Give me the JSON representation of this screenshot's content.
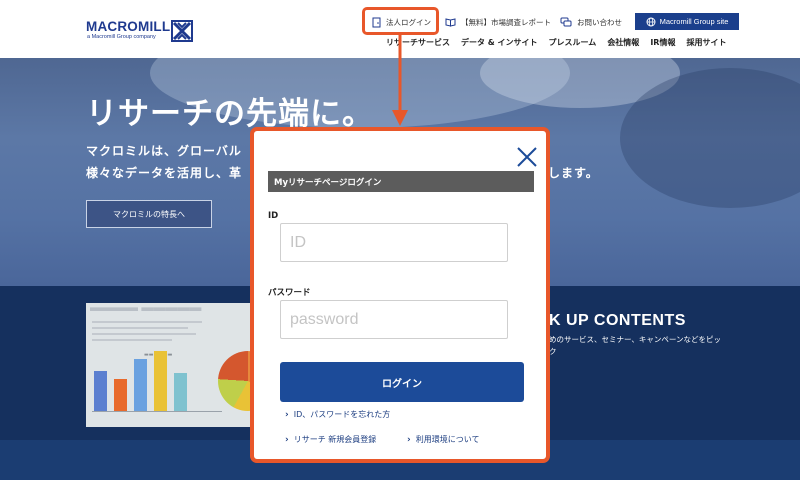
{
  "brand": {
    "name": "MACROMILL",
    "tagline": "a Macromill Group company",
    "primary_color": "#1f3a8f",
    "accent_color": "#e8572a"
  },
  "header": {
    "utility": {
      "corporate_login": "法人ログイン",
      "market_report": "【無料】市場調査レポート",
      "contact": "お問い合わせ",
      "group_site": "Macromill Group site"
    },
    "nav": [
      {
        "label": "リサーチサービス"
      },
      {
        "label": "データ & インサイト"
      },
      {
        "label": "プレスルーム"
      },
      {
        "label": "会社情報"
      },
      {
        "label": "IR情報"
      },
      {
        "label": "採用サイト"
      }
    ]
  },
  "hero": {
    "title": "リサーチの先端に。",
    "line1": "マクロミルは、グローバル",
    "line2": "様々なデータを活用し、革",
    "line2_end": "します。",
    "button": "マクロミルの特長へ"
  },
  "pickup": {
    "title": "K UP CONTENTS",
    "description": "めのサービス、セミナー、キャンペーンなどをピッ",
    "description2": "ク"
  },
  "modal": {
    "heading": "Myリサーチページログイン",
    "id_label": "ID",
    "id_placeholder": "ID",
    "password_label": "パスワード",
    "password_placeholder": "password",
    "login_button": "ログイン",
    "forgot_link": "ID、パスワードを忘れた方",
    "register_link": "リサーチ 新規会員登録",
    "environment_link": "利用環境について"
  },
  "icons": {
    "close": "close-icon",
    "door": "door-icon",
    "book": "book-icon",
    "chat": "chat-icon",
    "globe": "globe-icon",
    "chevron": "chevron-right-icon",
    "arrow": "arrow-down-icon"
  }
}
